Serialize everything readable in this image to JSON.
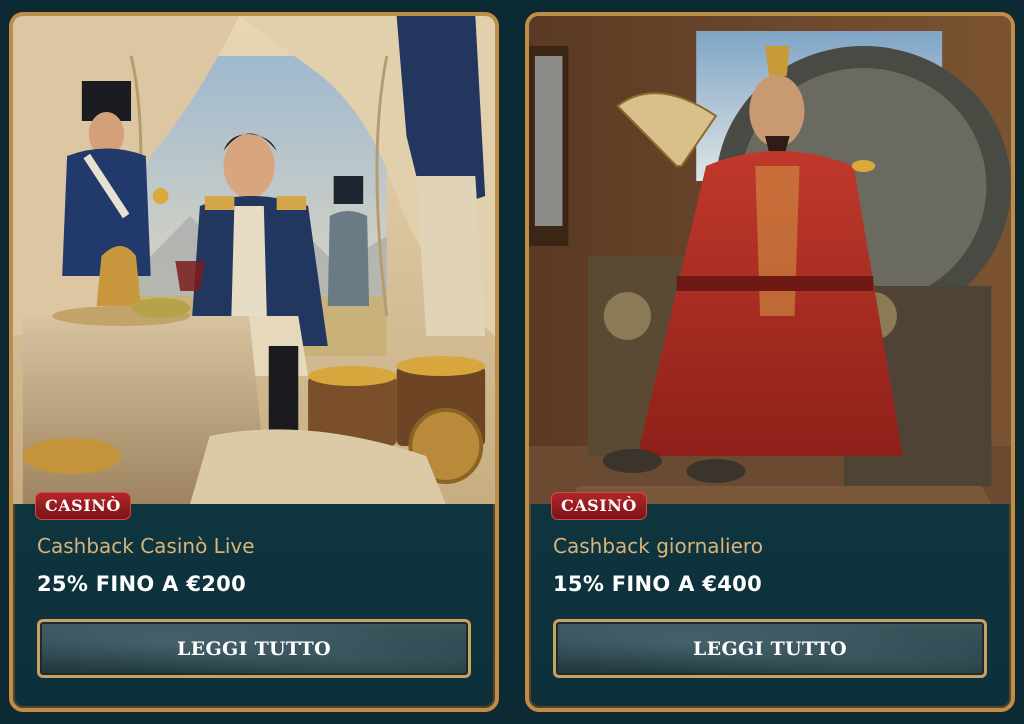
{
  "cards": [
    {
      "badge": "CASINÒ",
      "title": "Cashback Casinò Live",
      "offer": "25% FINO A €200",
      "button_label": "LEGGI TUTTO",
      "artwork": "napoleon-officer-with-gold-illustration"
    },
    {
      "badge": "CASINÒ",
      "title": "Cashback giornaliero",
      "offer": "15% FINO A €400",
      "button_label": "LEGGI TUTTO",
      "artwork": "chinese-emperor-on-throne-illustration"
    }
  ],
  "colors": {
    "background": "#0c2a33",
    "frame_gold": "#b98f4e",
    "badge_red": "#9c1d21",
    "title_gold": "#d9b37a"
  }
}
